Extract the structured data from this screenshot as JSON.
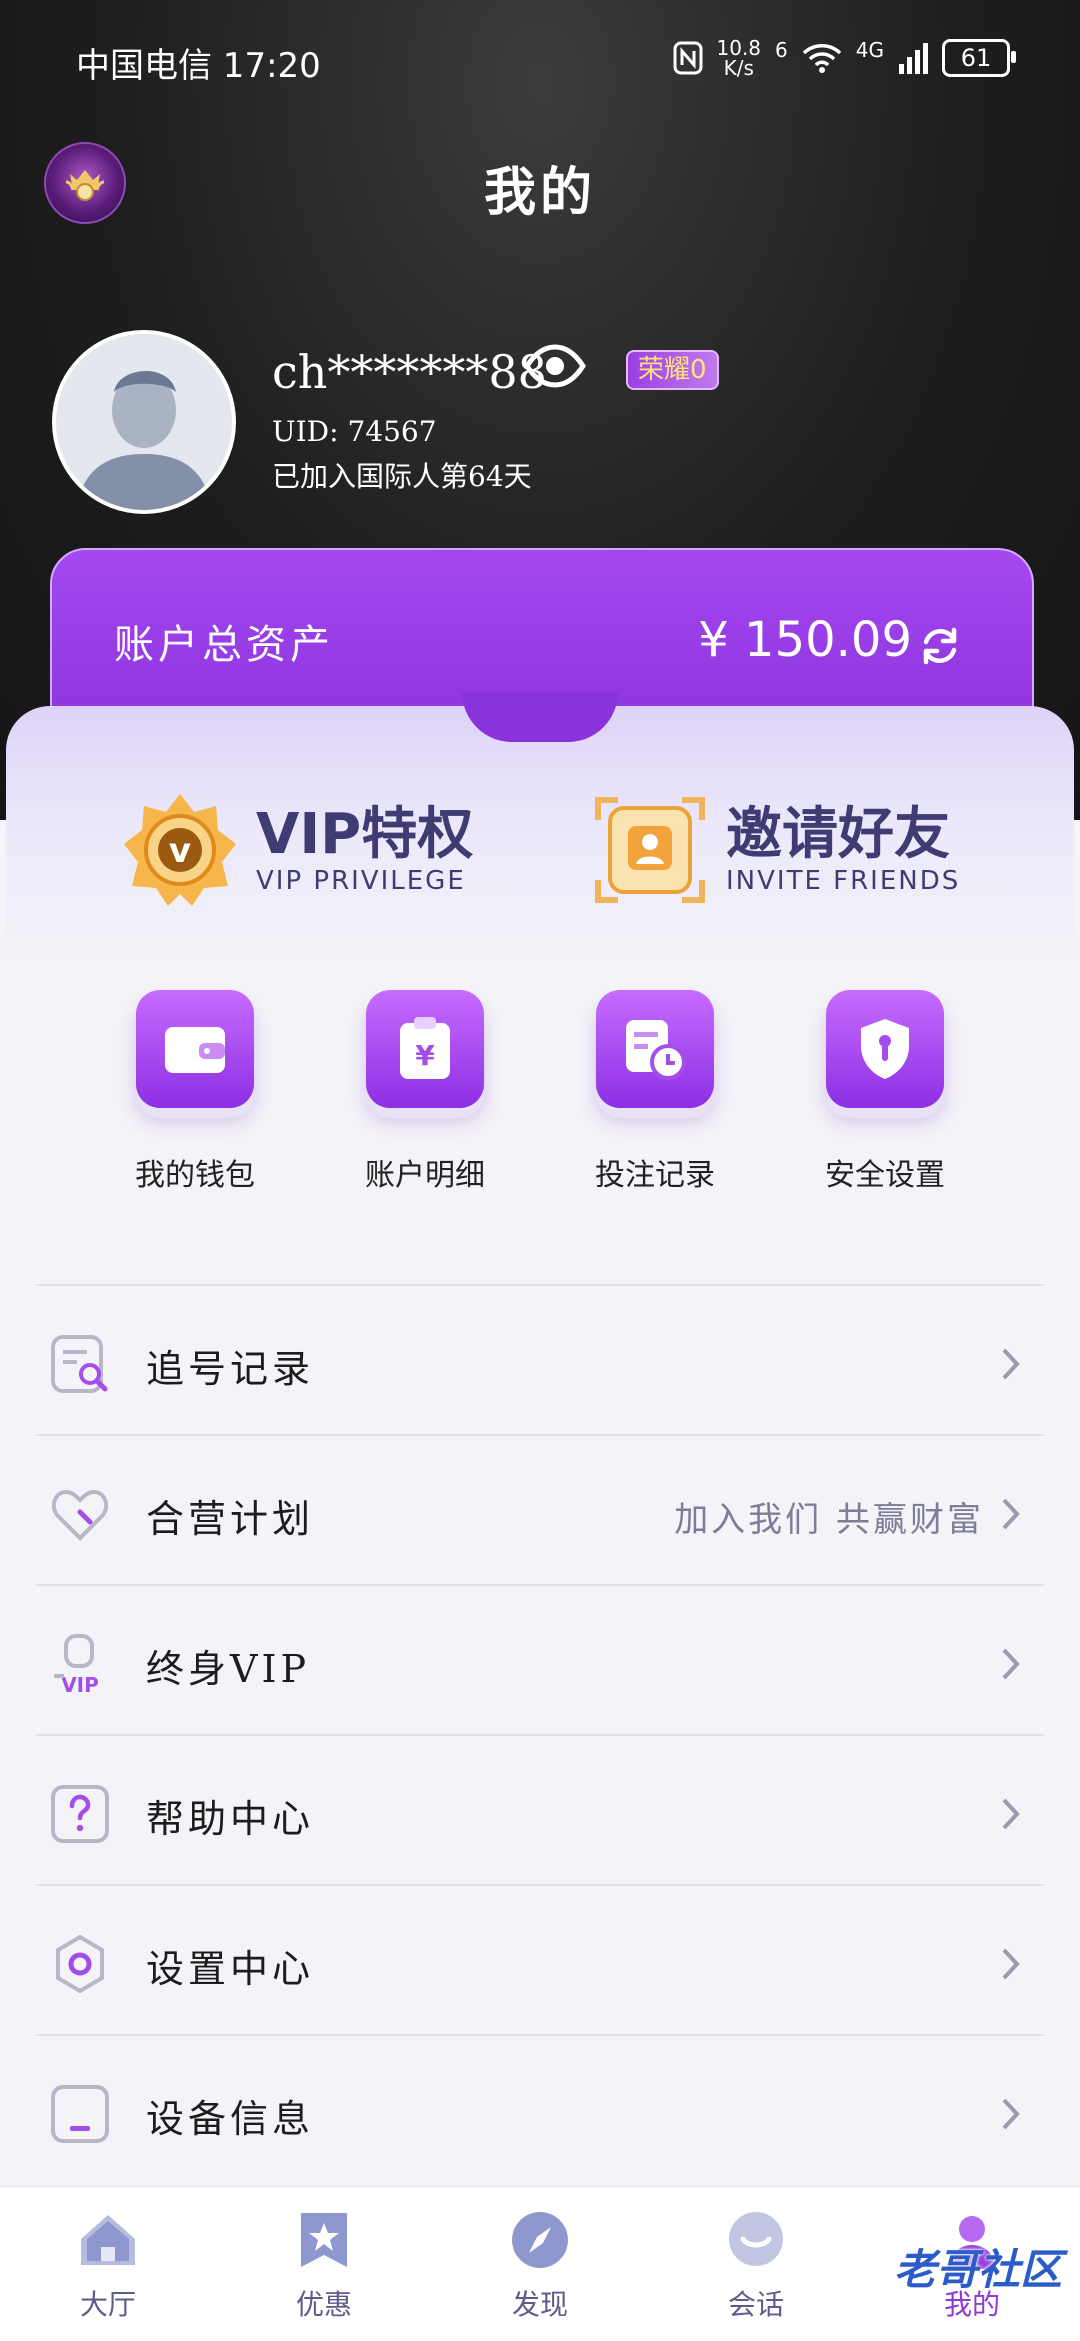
{
  "status_bar": {
    "carrier_time": "中国电信 17:20",
    "net_speed_value": "10.8",
    "net_speed_unit": "K/s",
    "sim_slot": "6",
    "network": "4G",
    "battery": "61"
  },
  "header": {
    "title": "我的"
  },
  "profile": {
    "username": "ch*******88",
    "badge": "荣耀0",
    "uid": "UID: 74567",
    "joined": "已加入国际人第64天"
  },
  "assets": {
    "label": "账户总资产",
    "value": "¥ 150.09"
  },
  "promos": [
    {
      "title": "VIP特权",
      "subtitle": "VIP PRIVILEGE"
    },
    {
      "title": "邀请好友",
      "subtitle": "INVITE FRIENDS"
    }
  ],
  "quick_actions": [
    {
      "label": "我的钱包",
      "icon": "wallet-icon"
    },
    {
      "label": "账户明细",
      "icon": "bill-icon"
    },
    {
      "label": "投注记录",
      "icon": "record-clock-icon"
    },
    {
      "label": "安全设置",
      "icon": "shield-icon"
    }
  ],
  "menu": [
    {
      "label": "追号记录",
      "icon": "search-doc-icon",
      "subtext": ""
    },
    {
      "label": "合营计划",
      "icon": "heart-handshake-icon",
      "subtext": "加入我们 共赢财富"
    },
    {
      "label": "终身VIP",
      "icon": "vip-user-icon",
      "subtext": ""
    },
    {
      "label": "帮助中心",
      "icon": "help-icon",
      "subtext": ""
    },
    {
      "label": "设置中心",
      "icon": "settings-gear-icon",
      "subtext": ""
    },
    {
      "label": "设备信息",
      "icon": "device-icon",
      "subtext": ""
    }
  ],
  "bottom_nav": [
    {
      "label": "大厅",
      "icon": "home-icon"
    },
    {
      "label": "优惠",
      "icon": "star-bookmark-icon"
    },
    {
      "label": "发现",
      "icon": "compass-icon"
    },
    {
      "label": "会话",
      "icon": "chat-icon"
    },
    {
      "label": "我的",
      "icon": "user-icon",
      "active": true
    }
  ],
  "watermark": "老哥社区",
  "colors": {
    "accent": "#9b3fe0",
    "text_dark": "#3e3c72",
    "nav_text": "#5c5c8a"
  }
}
